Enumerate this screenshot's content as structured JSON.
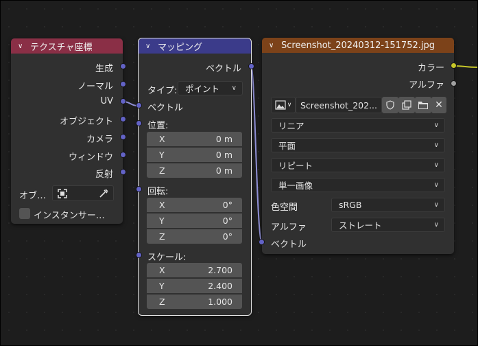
{
  "colors": {
    "tex_coord_header": "#8a2f46",
    "mapping_header": "#3b3b8a",
    "image_header": "#7c4219",
    "vector_socket": "#6363c7",
    "color_socket": "#c7c729",
    "gray_socket": "#a1a1a1"
  },
  "tex_coord": {
    "title": "テクスチャ座標",
    "outputs": [
      "生成",
      "ノーマル",
      "UV",
      "オブジェクト",
      "カメラ",
      "ウィンドウ",
      "反射"
    ],
    "object_label": "オブ…",
    "instancer_label": "インスタンサー…"
  },
  "mapping": {
    "title": "マッピング",
    "output_vector": "ベクトル",
    "type_label": "タイプ:",
    "type_value": "ポイント",
    "input_vector": "ベクトル",
    "location_label": "位置:",
    "location": [
      {
        "axis": "X",
        "value": "0 m"
      },
      {
        "axis": "Y",
        "value": "0 m"
      },
      {
        "axis": "Z",
        "value": "0 m"
      }
    ],
    "rotation_label": "回転:",
    "rotation": [
      {
        "axis": "X",
        "value": "0°"
      },
      {
        "axis": "Y",
        "value": "0°"
      },
      {
        "axis": "Z",
        "value": "0°"
      }
    ],
    "scale_label": "スケール:",
    "scale": [
      {
        "axis": "X",
        "value": "2.700"
      },
      {
        "axis": "Y",
        "value": "2.400"
      },
      {
        "axis": "Z",
        "value": "1.000"
      }
    ]
  },
  "image_tex": {
    "title": "Screenshot_20240312-151752.jpg",
    "out_color": "カラー",
    "out_alpha": "アルファ",
    "image_name": "Screenshot_202...",
    "interpolation": "リニア",
    "projection": "平面",
    "extension": "リピート",
    "source": "単一画像",
    "colorspace_label": "色空間",
    "colorspace_value": "sRGB",
    "alpha_label": "アルファ",
    "alpha_value": "ストレート",
    "input_vector": "ベクトル"
  }
}
